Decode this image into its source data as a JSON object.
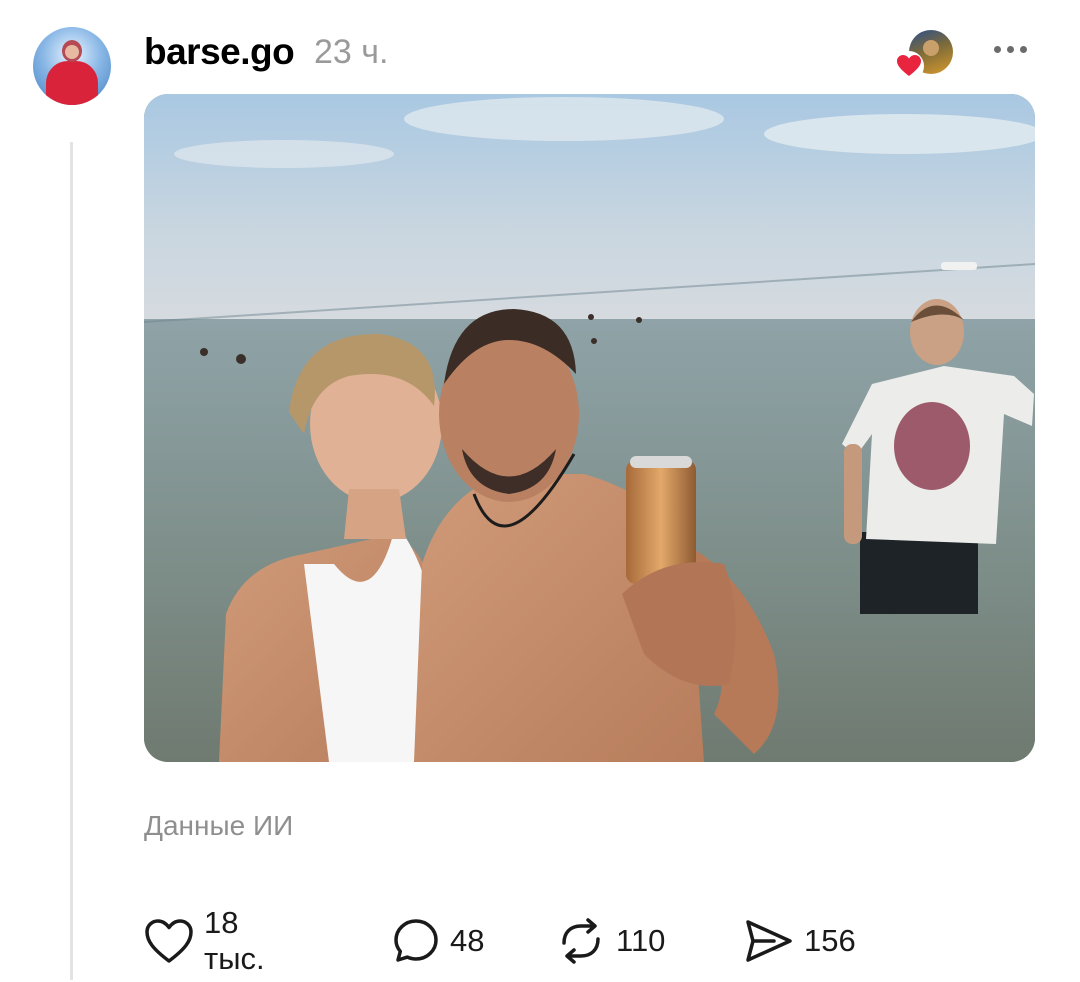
{
  "post": {
    "username": "barse.go",
    "time": "23 ч.",
    "ai_label": "Данные ИИ"
  },
  "icons": {
    "avatar": "user-avatar",
    "liker": "liker-avatar",
    "heart_badge": "heart-icon",
    "more": "more-horizontal-icon",
    "like": "heart-outline-icon",
    "comment": "speech-bubble-icon",
    "repost": "repost-icon",
    "share": "send-icon"
  },
  "colors": {
    "heart_badge": "#e8243f",
    "muted_text": "#9a9a9a",
    "thread_line": "#e3e3e3"
  },
  "actions": {
    "likes": "18 тыс.",
    "comments": "48",
    "reposts": "110",
    "shares": "156"
  }
}
